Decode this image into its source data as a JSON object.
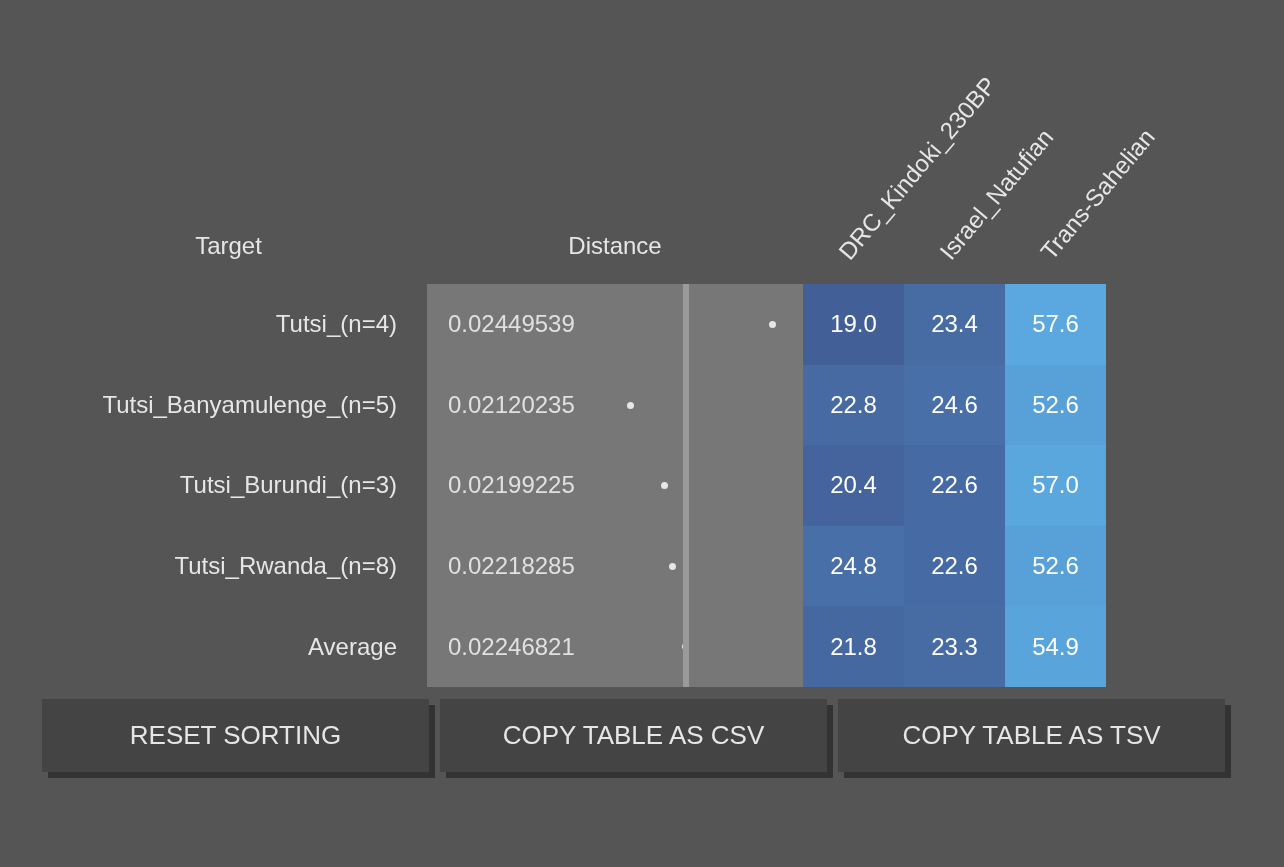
{
  "table": {
    "columns": [
      {
        "label": "Target"
      },
      {
        "label": "Distance"
      },
      {
        "label": "DRC_Kindoki_230BP"
      },
      {
        "label": "Israel_Natufian"
      },
      {
        "label": "Trans-Sahelian"
      }
    ],
    "rows": [
      {
        "target": "Tutsi_(n=4)",
        "distance": "0.02449539",
        "values": [
          "19.0",
          "23.4",
          "57.6"
        ]
      },
      {
        "target": "Tutsi_Banyamulenge_(n=5)",
        "distance": "0.02120235",
        "values": [
          "22.8",
          "24.6",
          "52.6"
        ]
      },
      {
        "target": "Tutsi_Burundi_(n=3)",
        "distance": "0.02199225",
        "values": [
          "20.4",
          "22.6",
          "57.0"
        ]
      },
      {
        "target": "Tutsi_Rwanda_(n=8)",
        "distance": "0.02218285",
        "values": [
          "24.8",
          "22.6",
          "52.6"
        ]
      },
      {
        "target": "Average",
        "distance": "0.02246821",
        "values": [
          "21.8",
          "23.3",
          "54.9"
        ]
      }
    ]
  },
  "buttons": [
    "RESET SORTING",
    "COPY TABLE AS CSV",
    "COPY TABLE AS TSV"
  ]
}
